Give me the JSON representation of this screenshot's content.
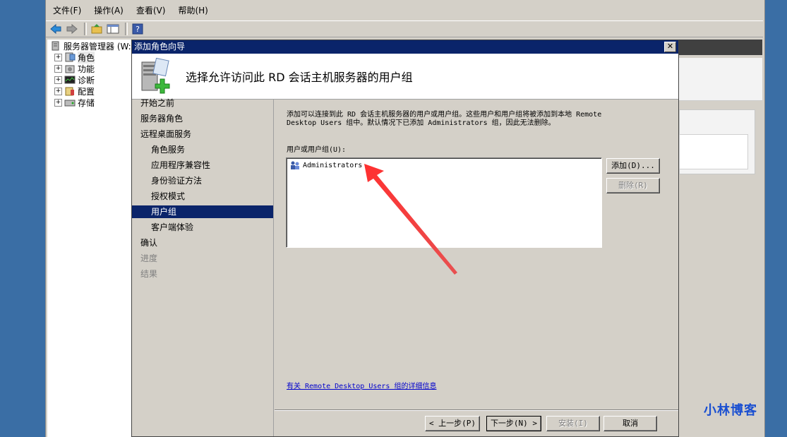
{
  "menubar": {
    "items": [
      "文件(F)",
      "操作(A)",
      "查看(V)",
      "帮助(H)"
    ]
  },
  "tree": {
    "root": "服务器管理器 (W:",
    "items": [
      "角色",
      "功能",
      "诊断",
      "配置",
      "存储"
    ]
  },
  "dialog": {
    "title": "添加角色向导",
    "close_label": "✕",
    "header_title": "选择允许访问此 RD 会话主机服务器的用户组",
    "nav": [
      {
        "label": "开始之前",
        "level": 1,
        "state": "normal"
      },
      {
        "label": "服务器角色",
        "level": 1,
        "state": "normal"
      },
      {
        "label": "远程桌面服务",
        "level": 1,
        "state": "normal"
      },
      {
        "label": "角色服务",
        "level": 2,
        "state": "normal"
      },
      {
        "label": "应用程序兼容性",
        "level": 2,
        "state": "normal"
      },
      {
        "label": "身份验证方法",
        "level": 2,
        "state": "normal"
      },
      {
        "label": "授权模式",
        "level": 2,
        "state": "normal"
      },
      {
        "label": "用户组",
        "level": 2,
        "state": "selected"
      },
      {
        "label": "客户端体验",
        "level": 2,
        "state": "normal"
      },
      {
        "label": "确认",
        "level": 1,
        "state": "normal"
      },
      {
        "label": "进度",
        "level": 1,
        "state": "disabled"
      },
      {
        "label": "结果",
        "level": 1,
        "state": "disabled"
      }
    ],
    "description_line1": "添加可以连接到此 RD 会话主机服务器的用户或用户组。这些用户和用户组将被添加到本地 Remote",
    "description_line2": "Desktop Users 组中。默认情况下已添加 Administrators 组，因此无法删除。",
    "list_label": "用户或用户组(U):",
    "list_items": [
      "Administrators"
    ],
    "add_button": "添加(D)...",
    "remove_button": "删除(R)",
    "more_info_link": "有关 Remote Desktop Users 组的详细信息",
    "back_button": "< 上一步(P)",
    "next_button": "下一步(N) >",
    "install_button": "安装(I)",
    "cancel_button": "取消"
  },
  "watermark": "小林博客",
  "colors": {
    "desktop": "#3a6ea5",
    "titlebar": "#0a246a",
    "selection": "#0a246a",
    "arrow": "#f04040",
    "link": "#0000cc"
  }
}
